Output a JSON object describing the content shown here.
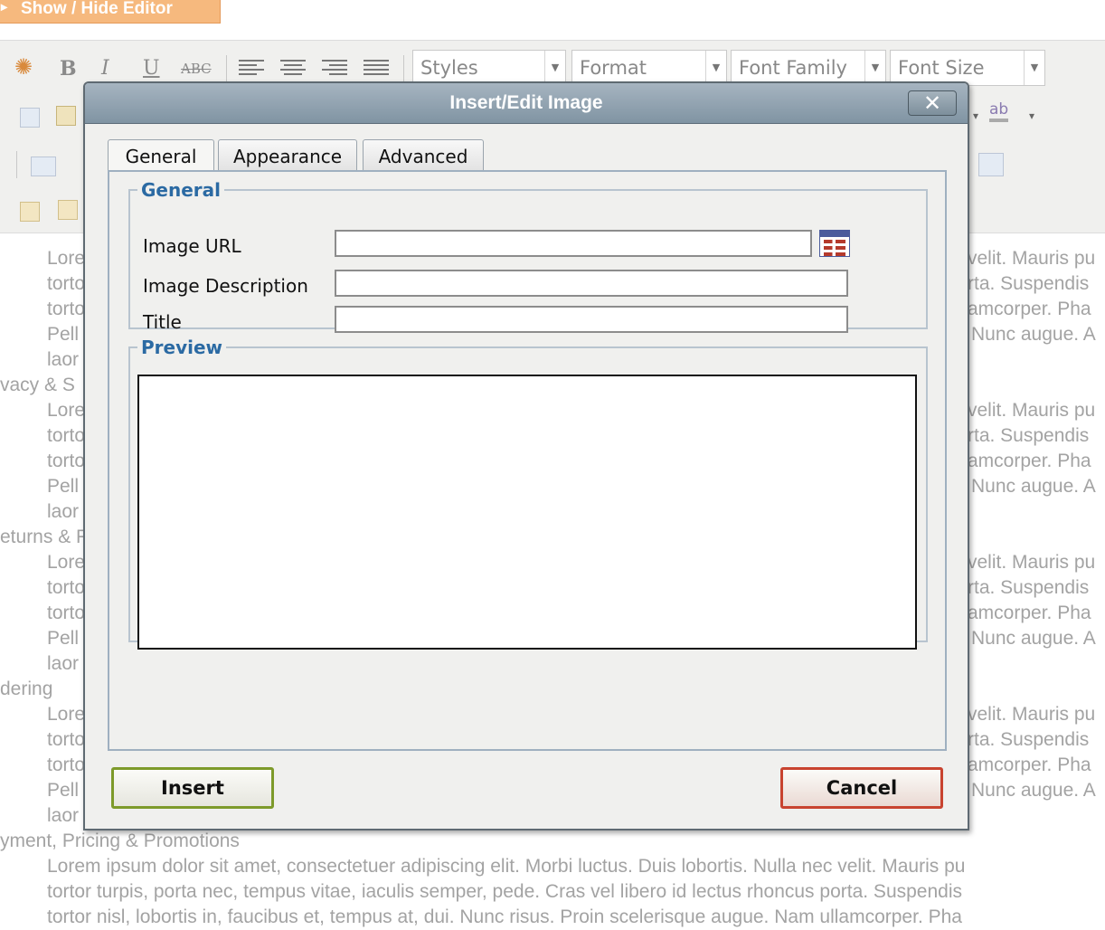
{
  "page": {
    "show_hide_label": "Show / Hide Editor",
    "toolbar": {
      "bold": "B",
      "italic": "I",
      "underline": "U",
      "strikethrough": "ABC",
      "styles_select": "Styles",
      "format_select": "Format",
      "font_family_select": "Font Family",
      "font_size_select": "Font Size",
      "spell_label": "ab"
    },
    "left_fragments": {
      "line1": "Lore",
      "line2": "torto",
      "line3": "torto",
      "line4": "Pell",
      "line5": "laor",
      "heading_privacy": "vacy & S",
      "line6": "Lore",
      "line7": "torto",
      "line8": "torto",
      "line9": "Pell",
      "line10": "laor",
      "heading_returns": "eturns & F",
      "line11": "Lore",
      "line12": "torto",
      "line13": "torto",
      "line14": "Pell",
      "line15": "laor",
      "heading_ordering": "dering",
      "line16": "Lore",
      "line17": "torto",
      "line18": "torto",
      "line19": "Pell",
      "line20": "laor"
    },
    "right_fragments": {
      "r1": "velit. Mauris pu",
      "r2": "rta. Suspendis",
      "r3": "amcorper. Pha",
      "r4": "Nunc augue. A",
      "r5": "velit. Mauris pu",
      "r6": "rta. Suspendis",
      "r7": "amcorper. Pha",
      "r8": "Nunc augue. A",
      "r9": "velit. Mauris pu",
      "r10": "rta. Suspendis",
      "r11": "amcorper. Pha",
      "r12": "Nunc augue. A",
      "r13": "velit. Mauris pu",
      "r14": "rta. Suspendis",
      "r15": "amcorper. Pha",
      "r16": "Nunc augue. A"
    },
    "bottom": {
      "heading_payment": "yment, Pricing & Promotions",
      "para_line1": "Lorem ipsum dolor sit amet, consectetuer adipiscing elit. Morbi luctus. Duis lobortis. Nulla nec velit. Mauris pu",
      "para_line2": "tortor turpis, porta nec, tempus vitae, iaculis semper, pede. Cras vel libero id lectus rhoncus porta. Suspendis",
      "para_line3": "tortor nisl, lobortis in, faucibus et, tempus at, dui. Nunc risus. Proin scelerisque augue. Nam ullamcorper. Pha"
    }
  },
  "dialog": {
    "title": "Insert/Edit Image",
    "close_label": "✕",
    "tabs": [
      {
        "label": "General",
        "active": true
      },
      {
        "label": "Appearance",
        "active": false
      },
      {
        "label": "Advanced",
        "active": false
      }
    ],
    "general": {
      "legend": "General",
      "image_url_label": "Image URL",
      "image_url_value": "",
      "image_description_label": "Image Description",
      "image_description_value": "",
      "title_label": "Title",
      "title_value": ""
    },
    "preview": {
      "legend": "Preview"
    },
    "insert_label": "Insert",
    "cancel_label": "Cancel"
  },
  "colors": {
    "accent_legend": "#2b6aa3",
    "insert_border": "#7d9a2a",
    "cancel_border": "#c8432f",
    "show_hide_bg": "#f6b97e"
  }
}
